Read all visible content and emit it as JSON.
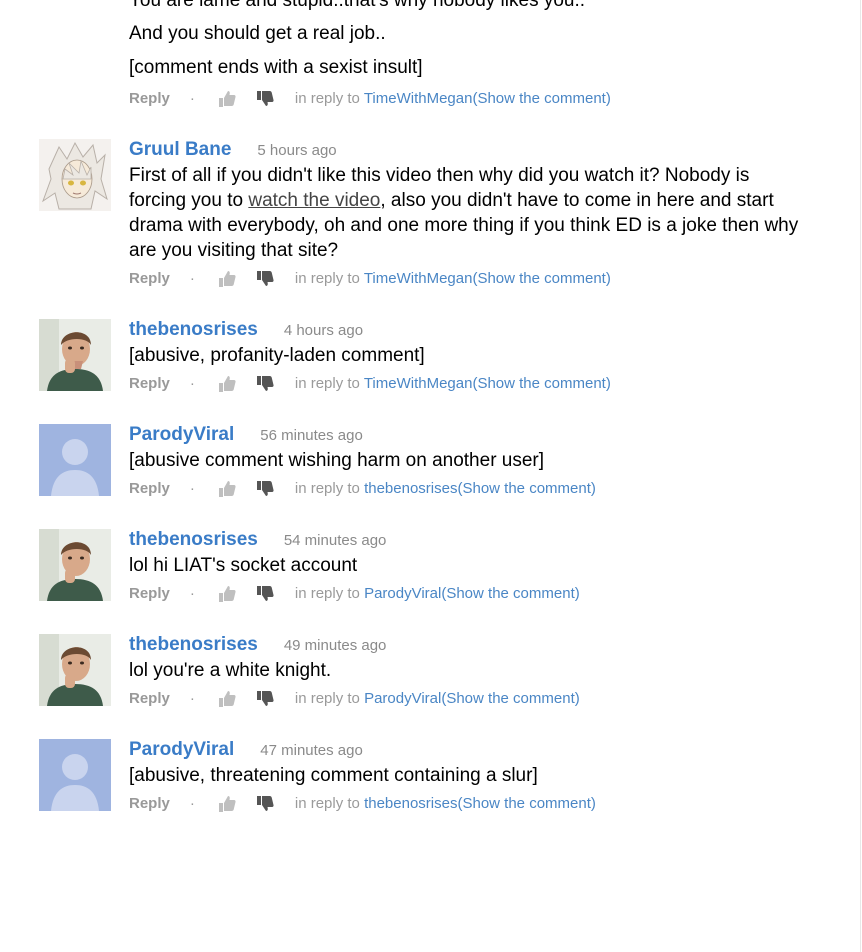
{
  "ui": {
    "reply_label": "Reply",
    "dot": "·",
    "in_reply_to": "in reply to",
    "show_comment": "(Show the comment)"
  },
  "comments": [
    {
      "author": "",
      "time": "",
      "avatar": "none",
      "lines": [
        "You are lame and stupid..that's why nobody likes you..",
        "And you should get a real job..",
        "[comment ends with a sexist insult]"
      ],
      "reply_to": "TimeWithMegan"
    },
    {
      "author": "Gruul Bane",
      "time": "5 hours ago",
      "avatar": "anime",
      "text_before_link": "First of all if you didn't like this video then why did you watch it? Nobody is forcing you to ",
      "link_text": "watch the video",
      "text_after_link": ", also you didn't have to come in here and start drama with everybody, oh and one more thing if you think ED is a joke then why are you visiting that site?",
      "reply_to": "TimeWithMegan"
    },
    {
      "author": "thebenosrises",
      "time": "4 hours ago",
      "avatar": "person",
      "text": "[abusive, profanity-laden comment]",
      "reply_to": "TimeWithMegan"
    },
    {
      "author": "ParodyViral",
      "time": "56 minutes ago",
      "avatar": "default",
      "text": "[abusive comment wishing harm on another user]",
      "reply_to": "thebenosrises"
    },
    {
      "author": "thebenosrises",
      "time": "54 minutes ago",
      "avatar": "person",
      "text": "lol hi LIAT's socket account",
      "reply_to": "ParodyViral"
    },
    {
      "author": "thebenosrises",
      "time": "49 minutes ago",
      "avatar": "person",
      "text": "lol you're a white knight.",
      "reply_to": "ParodyViral"
    },
    {
      "author": "ParodyViral",
      "time": "47 minutes ago",
      "avatar": "default",
      "text": "[abusive, threatening comment containing a slur]",
      "reply_to": "thebenosrises"
    }
  ]
}
